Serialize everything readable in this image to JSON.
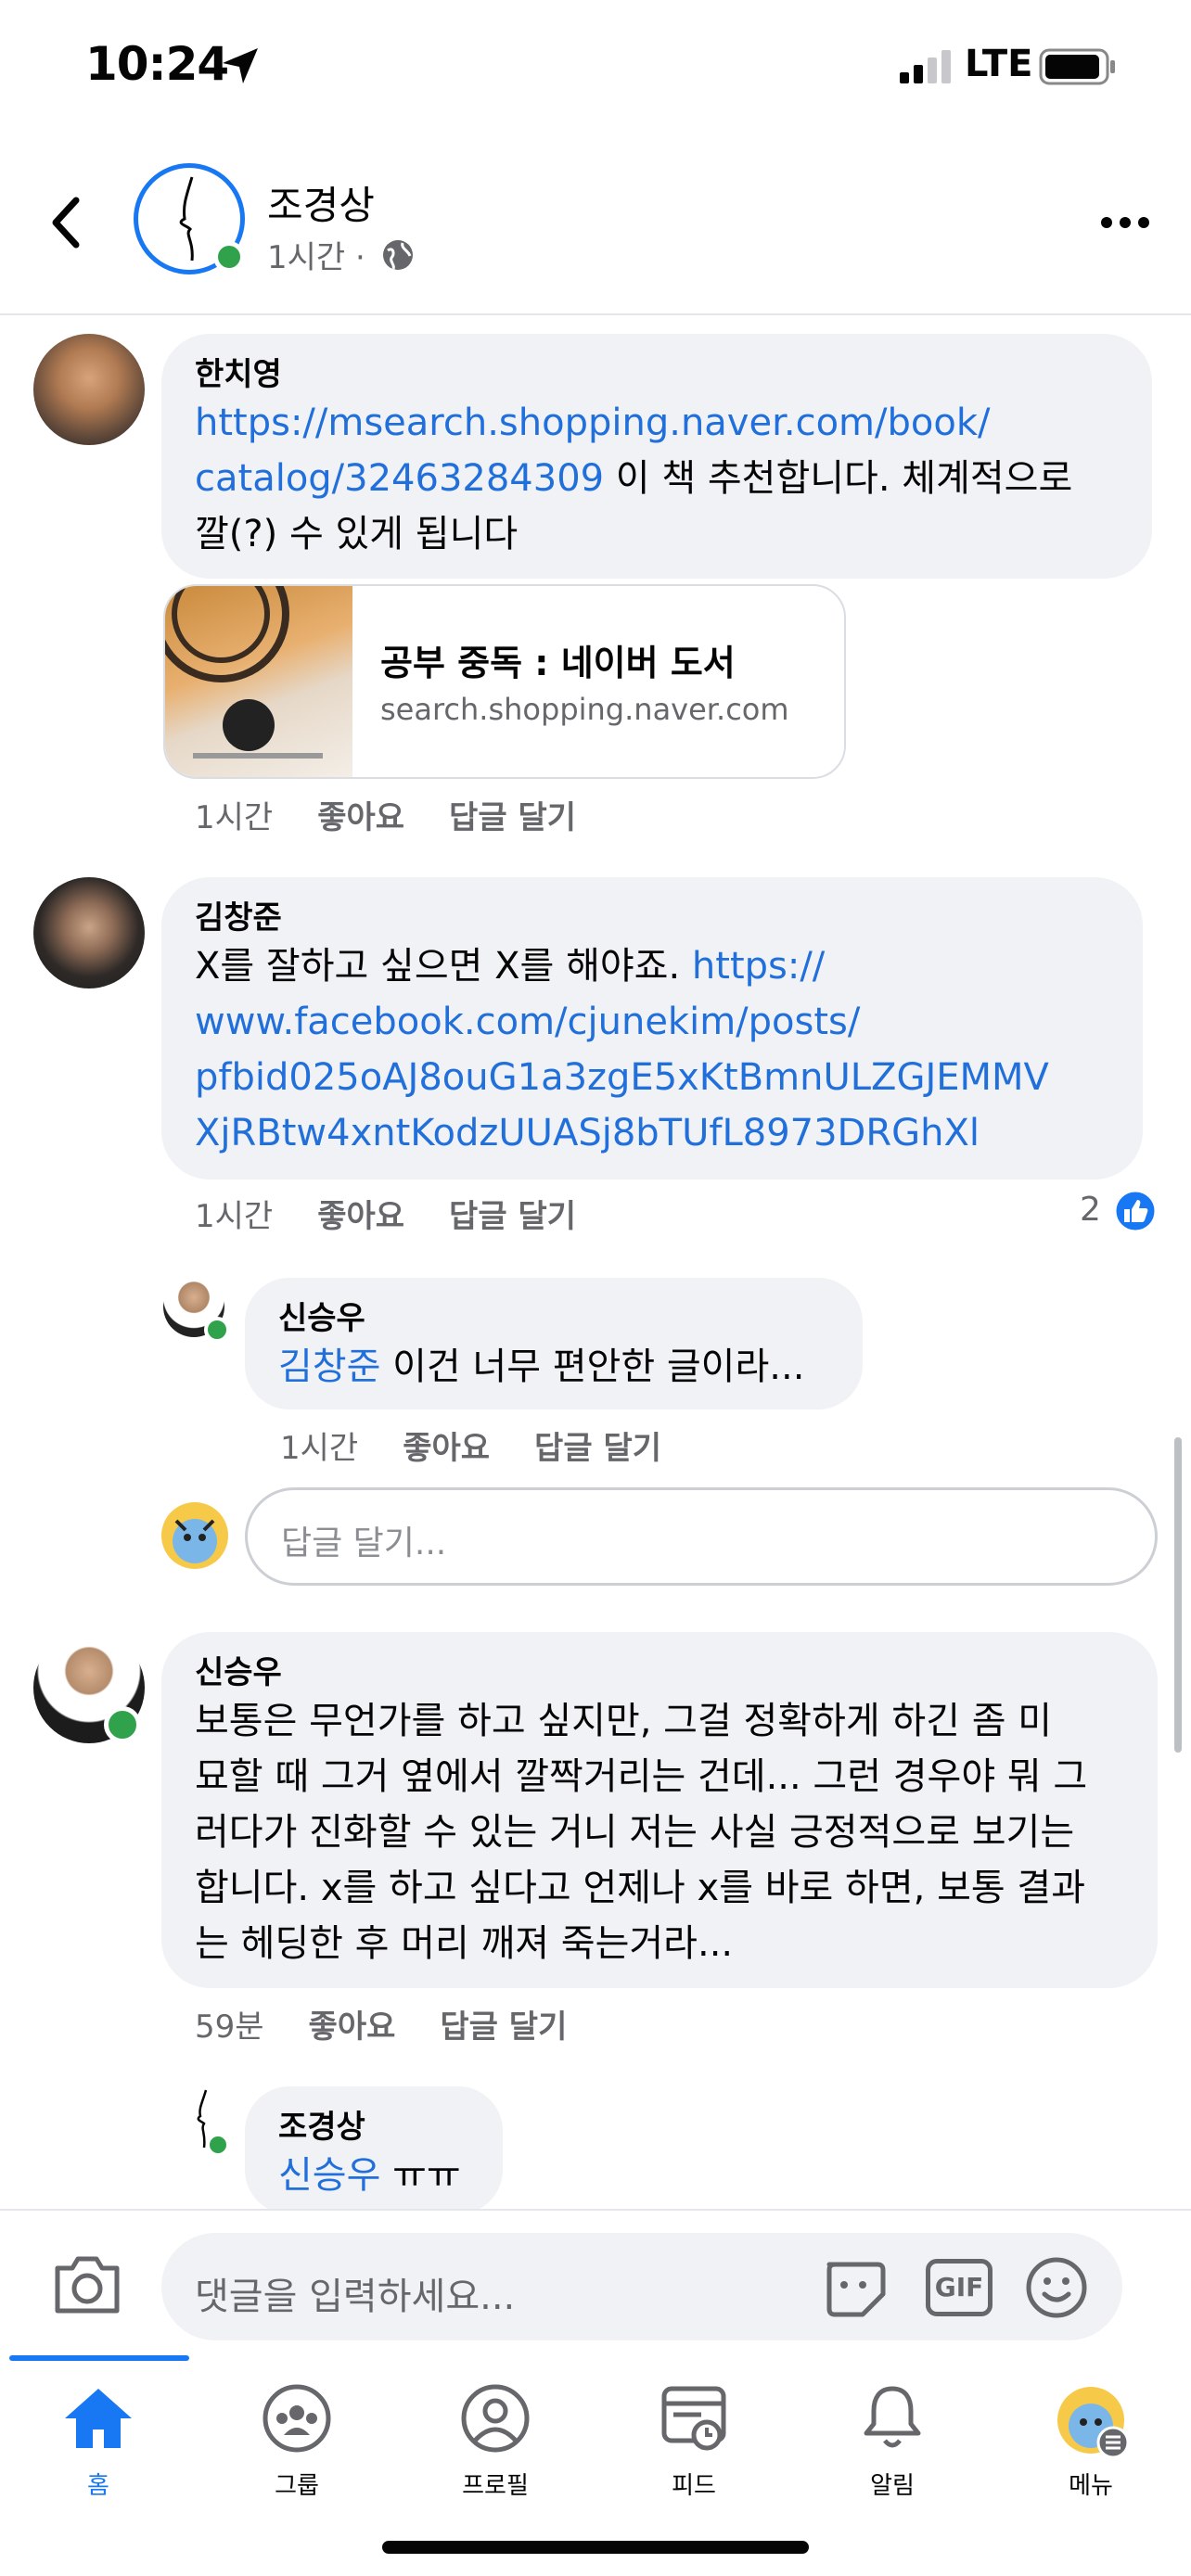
{
  "status": {
    "time": "10:24",
    "network": "LTE"
  },
  "header": {
    "name": "조경상",
    "time": "1시간 ·"
  },
  "comments": [
    {
      "author": "한치영",
      "link1": "https://msearch.shopping.naver.com/book/",
      "link2": "catalog/32463284309",
      "text_after": " 이 책 추천합니다. 체계적으로",
      "text_line3": "깔(?) 수 있게 됩니다",
      "preview_title": "공부 중독 : 네이버 도서",
      "preview_domain": "search.shopping.naver.com",
      "time": "1시간",
      "like": "좋아요",
      "reply": "답글 달기"
    },
    {
      "author": "김창준",
      "line1_text": "X를 잘하고 싶으면 X를 해야죠. ",
      "line1_link": "https://",
      "link2": "www.facebook.com/cjunekim/posts/",
      "link3": "pfbid025oAJ8ouG1a3zgE5xKtBmnULZGJEMMV",
      "link4": "XjRBtw4xntKodzUUASj8bTUfL8973DRGhXl",
      "time": "1시간",
      "like": "좋아요",
      "reply": "답글 달기",
      "reactions": "2"
    },
    {
      "author": "신승우",
      "mention": "김창준",
      "text": " 이건 너무 편안한 글이라...",
      "time": "1시간",
      "like": "좋아요",
      "reply": "답글 달기"
    },
    {
      "author": "신승우",
      "lines": [
        "보통은 무언가를 하고 싶지만, 그걸 정확하게 하긴 좀 미",
        "묘할 때 그거 옆에서 깔짝거리는 건데... 그런 경우야 뭐 그",
        "러다가 진화할 수 있는 거니 저는 사실 긍정적으로 보기는",
        "합니다. x를 하고 싶다고 언제나 x를 바로 하면, 보통 결과",
        "는 헤딩한 후 머리 깨져 죽는거라..."
      ],
      "time": "59분",
      "like": "좋아요",
      "reply": "답글 달기"
    },
    {
      "author": "조경상",
      "mention": "신승우",
      "text": " ㅠㅠ"
    }
  ],
  "reply_input": {
    "placeholder": "답글 달기..."
  },
  "comment_input": {
    "placeholder": "댓글을 입력하세요...",
    "gif": "GIF"
  },
  "tabs": [
    {
      "label": "홈",
      "icon": "home-icon",
      "active": true
    },
    {
      "label": "그룹",
      "icon": "groups-icon"
    },
    {
      "label": "프로필",
      "icon": "profile-icon"
    },
    {
      "label": "피드",
      "icon": "feeds-icon"
    },
    {
      "label": "알림",
      "icon": "bell-icon"
    },
    {
      "label": "메뉴",
      "icon": "menu-avatar-icon"
    }
  ],
  "colors": {
    "accent": "#1877f2",
    "link": "#216fdb",
    "bubble": "#f0f2f5",
    "online": "#31a24c"
  }
}
